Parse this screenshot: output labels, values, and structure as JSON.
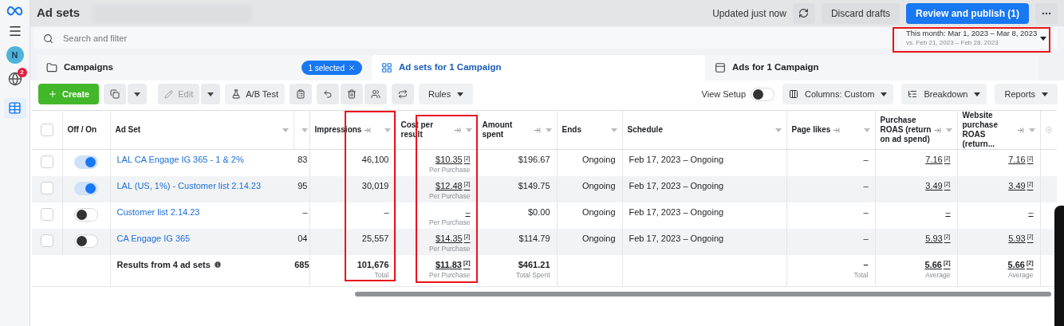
{
  "header": {
    "title": "Ad sets",
    "status": "Updated just now",
    "discard": "Discard drafts",
    "publish": "Review and publish (1)"
  },
  "sidebar": {
    "avatar": "N",
    "notifications": "2"
  },
  "search": {
    "placeholder": "Search and filter"
  },
  "date_range": {
    "label": "This month: Mar 1, 2023 – Mar 8, 2023",
    "compare": "vs. Feb 21, 2023 – Feb 28, 2023"
  },
  "tabs": [
    {
      "label": "Campaigns",
      "selected": false,
      "badge": "1 selected"
    },
    {
      "label": "Ad sets for 1 Campaign",
      "selected": true
    },
    {
      "label": "Ads for 1 Campaign",
      "selected": false
    }
  ],
  "toolbar": {
    "create": "Create",
    "edit": "Edit",
    "ab_test": "A/B Test",
    "rules": "Rules",
    "view_setup": {
      "label": "View Setup",
      "on": false
    },
    "columns": "Columns: Custom",
    "breakdown": "Breakdown",
    "reports": "Reports"
  },
  "table": {
    "select_all_checked": false,
    "columns": [
      {
        "label": "Off / On",
        "kind": "plain"
      },
      {
        "label": "Ad Set",
        "kind": "plain"
      },
      {
        "kind": "cut"
      },
      {
        "label": "Impressions",
        "kind": "metric"
      },
      {
        "label": "Cost per result",
        "kind": "metric"
      },
      {
        "label": "Amount spent",
        "kind": "metric"
      },
      {
        "label": "Ends",
        "kind": "plain"
      },
      {
        "label": "Schedule",
        "kind": "plain"
      },
      {
        "label": "Page likes",
        "kind": "metric"
      },
      {
        "label": "Purchase ROAS (return on ad spend)",
        "kind": "metric"
      },
      {
        "label": "Website purchase ROAS (return...",
        "kind": "metric"
      }
    ],
    "rows": [
      {
        "checked": false,
        "on": true,
        "name": "LAL CA Engage IG 365 - 1 & 2%",
        "column_3": "83",
        "impressions": "46,100",
        "cost": "$10.35$^{[2]}$",
        "cost_note": "Per Purchase",
        "amount": "$196.67",
        "ends": "Ongoing",
        "schedule": "Feb 17, 2023 – Ongoing",
        "page_likes": "–",
        "purchase_roas": "7.16$^{[2]}$",
        "website_roas": "7.16$^{[2]}$"
      },
      {
        "checked": false,
        "on": true,
        "name": "LAL (US, 1%) - Customer list 2.14.23",
        "column_3": "95",
        "impressions": "30,019",
        "cost": "$12.48$^{[2]}$",
        "cost_note": "Per Purchase",
        "amount": "$149.75",
        "ends": "Ongoing",
        "schedule": "Feb 17, 2023 – Ongoing",
        "page_likes": "–",
        "purchase_roas": "3.49$^{[2]}$",
        "website_roas": "3.49$^{[2]}$"
      },
      {
        "checked": false,
        "on": false,
        "name": "Customer list 2.14.23",
        "column_3": "–",
        "impressions": "–",
        "cost": "–",
        "cost_note": "Per Purchase",
        "amount": "$0.00",
        "ends": "Ongoing",
        "schedule": "Feb 17, 2023 – Ongoing",
        "page_likes": "–",
        "purchase_roas": "–",
        "website_roas": "–"
      },
      {
        "checked": false,
        "on": false,
        "name": "CA Engage IG 365",
        "column_3": "04",
        "impressions": "25,557",
        "cost": "$14.35$^{[2]}$",
        "cost_note": "Per Purchase",
        "amount": "$114.79",
        "ends": "Ongoing",
        "schedule": "Feb 17, 2023 – Ongoing",
        "page_likes": "–",
        "purchase_roas": "5.93$^{[2]}$",
        "website_roas": "5.93$^{[2]}$"
      }
    ],
    "total": {
      "label": "Results from 4 ad sets",
      "column_3": "685",
      "impressions": "101,676",
      "impressions_note": "Total",
      "cost": "$11.83$^{[2]}$",
      "cost_note": "Per Purchase",
      "amount": "$461.21",
      "amount_note": "Total Spent",
      "page_likes": "–",
      "page_likes_note": "Total",
      "purchase_roas": "5.66$^{[2]}$",
      "purchase_roas_note": "Average",
      "website_roas": "5.66$^{[2]}$",
      "website_roas_note": "Average"
    }
  }
}
